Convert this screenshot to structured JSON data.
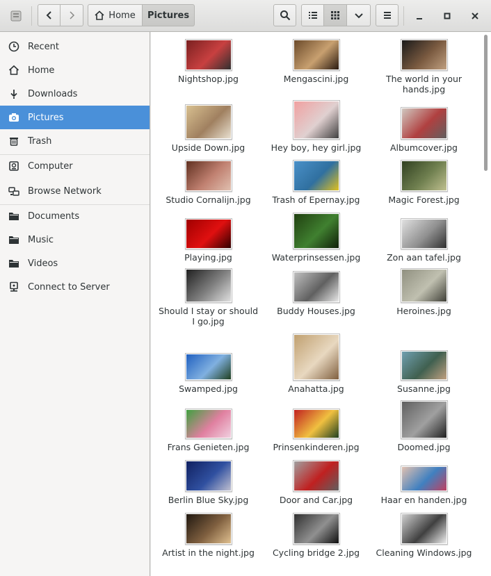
{
  "header": {
    "breadcrumbs": [
      {
        "label": "Home"
      },
      {
        "label": "Pictures"
      }
    ]
  },
  "sidebar": {
    "items": [
      {
        "label": "Recent",
        "icon": "clock-icon"
      },
      {
        "label": "Home",
        "icon": "home-icon"
      },
      {
        "label": "Downloads",
        "icon": "download-icon"
      },
      {
        "label": "Pictures",
        "icon": "camera-icon",
        "active": true
      },
      {
        "label": "Trash",
        "icon": "trash-icon"
      },
      {
        "label": "Computer",
        "icon": "computer-icon"
      },
      {
        "label": "Browse Network",
        "icon": "network-icon"
      },
      {
        "label": "Documents",
        "icon": "folder-icon"
      },
      {
        "label": "Music",
        "icon": "folder-icon"
      },
      {
        "label": "Videos",
        "icon": "folder-icon"
      },
      {
        "label": "Connect to Server",
        "icon": "server-icon"
      }
    ]
  },
  "files": [
    {
      "name": "Nightshop.jpg",
      "colors": [
        "#7a2020",
        "#c84040",
        "#303030"
      ]
    },
    {
      "name": "Mengascini.jpg",
      "colors": [
        "#6b4a2a",
        "#c8a070",
        "#2a1a10"
      ]
    },
    {
      "name": "The world in your hands.jpg",
      "colors": [
        "#1a1a1a",
        "#7a5a40",
        "#c0a080"
      ]
    },
    {
      "name": "Upside Down.jpg",
      "colors": [
        "#d8c090",
        "#a08060",
        "#e8e0d0"
      ]
    },
    {
      "name": "Hey boy, hey girl.jpg",
      "colors": [
        "#f0a0a0",
        "#e0d0d0",
        "#404040"
      ]
    },
    {
      "name": "Albumcover.jpg",
      "colors": [
        "#d0c8c0",
        "#b04040",
        "#606060"
      ]
    },
    {
      "name": "Studio Cornalijn.jpg",
      "colors": [
        "#603020",
        "#c08070",
        "#e0c0b0"
      ]
    },
    {
      "name": "Trash of Epernay.jpg",
      "colors": [
        "#4a90c8",
        "#3070a0",
        "#e0c020"
      ]
    },
    {
      "name": "Magic Forest.jpg",
      "colors": [
        "#304020",
        "#708050",
        "#c0c090"
      ]
    },
    {
      "name": "Playing.jpg",
      "colors": [
        "#a00000",
        "#e01010",
        "#300000"
      ]
    },
    {
      "name": "Waterprinsessen.jpg",
      "colors": [
        "#204010",
        "#408030",
        "#102008"
      ]
    },
    {
      "name": "Zon aan tafel.jpg",
      "colors": [
        "#e0e0e0",
        "#909090",
        "#303030"
      ]
    },
    {
      "name": "Should I stay or should I go.jpg",
      "colors": [
        "#202020",
        "#808080",
        "#e0e0e0"
      ]
    },
    {
      "name": "Buddy Houses.jpg",
      "colors": [
        "#c0c0c0",
        "#606060",
        "#e8e8e8"
      ]
    },
    {
      "name": "Heroines.jpg",
      "colors": [
        "#909080",
        "#c0c0b0",
        "#404038"
      ]
    },
    {
      "name": "Swamped.jpg",
      "colors": [
        "#2060c0",
        "#80b0e0",
        "#204020"
      ]
    },
    {
      "name": "Anahatta.jpg",
      "colors": [
        "#c0a070",
        "#e8d8c0",
        "#806040"
      ]
    },
    {
      "name": "Susanne.jpg",
      "colors": [
        "#70a0b0",
        "#406050",
        "#c0a080"
      ]
    },
    {
      "name": "Frans Genieten.jpg",
      "colors": [
        "#40a040",
        "#e080a0",
        "#f0d0e0"
      ]
    },
    {
      "name": "Prinsenkinderen.jpg",
      "colors": [
        "#c02020",
        "#f0c040",
        "#204020"
      ]
    },
    {
      "name": "Doomed.jpg",
      "colors": [
        "#606060",
        "#a0a0a0",
        "#202020"
      ]
    },
    {
      "name": "Berlin Blue Sky.jpg",
      "colors": [
        "#102060",
        "#3050a0",
        "#c0c0d0"
      ]
    },
    {
      "name": "Door and Car.jpg",
      "colors": [
        "#a0a0a0",
        "#c02020",
        "#606060"
      ]
    },
    {
      "name": "Haar en handen.jpg",
      "colors": [
        "#e0c0b0",
        "#4080c0",
        "#c04060"
      ]
    },
    {
      "name": "Artist in the night.jpg",
      "colors": [
        "#201810",
        "#806040",
        "#e0c090"
      ]
    },
    {
      "name": "Cycling bridge 2.jpg",
      "colors": [
        "#303030",
        "#909090",
        "#101010"
      ]
    },
    {
      "name": "Cleaning Windows.jpg",
      "colors": [
        "#d0d0d0",
        "#404040",
        "#f0f0f0"
      ]
    }
  ]
}
